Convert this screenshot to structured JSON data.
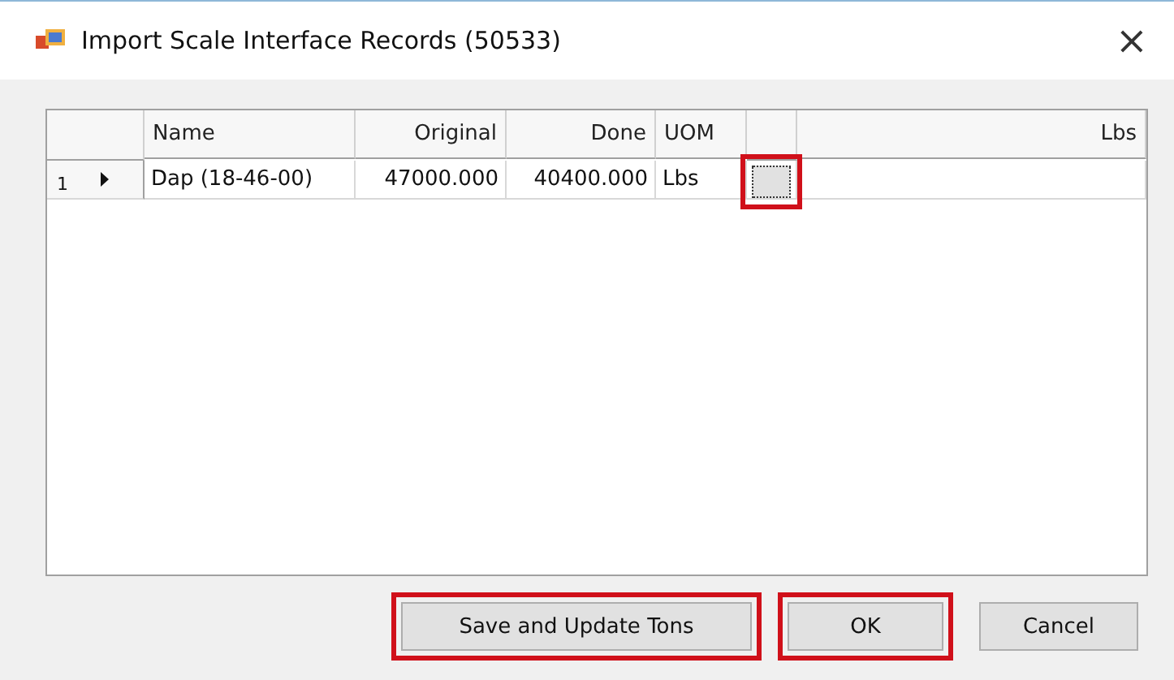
{
  "window": {
    "title": "Import Scale Interface Records (50533)",
    "close": "×"
  },
  "table": {
    "columns": [
      {
        "label": "Name"
      },
      {
        "label": "Original"
      },
      {
        "label": "Done"
      },
      {
        "label": "UOM"
      },
      {},
      {
        "label": "Lbs"
      }
    ],
    "rows": [
      {
        "number": "1",
        "current": true,
        "cells": [
          "Dap (18-46-00)",
          "47000.000",
          "40400.000",
          "Lbs"
        ],
        "button_highlighted": true
      }
    ]
  },
  "buttons": [
    {
      "label": "Save and Update Tons",
      "highlighted": true
    },
    {
      "label": "OK",
      "highlighted": true
    },
    {
      "label": "Cancel",
      "highlighted": false
    }
  ]
}
